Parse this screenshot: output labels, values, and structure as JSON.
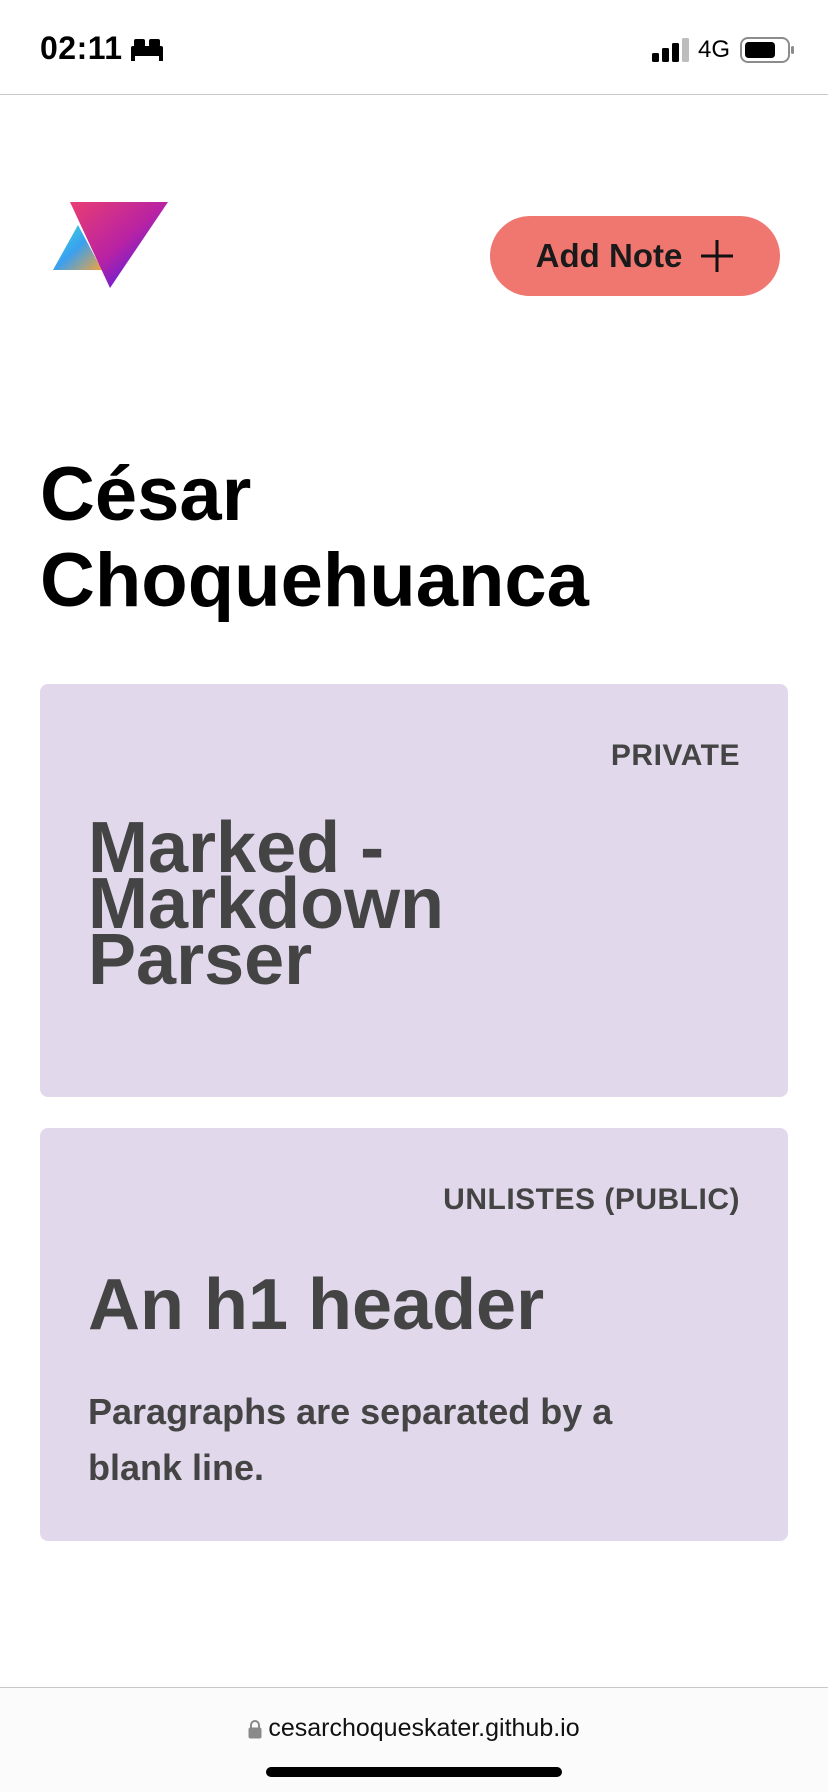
{
  "status_bar": {
    "time": "02:11",
    "network": "4G",
    "icons": [
      "sleep-icon",
      "signal-icon",
      "battery-icon"
    ]
  },
  "header": {
    "logo": "gradient-triangles-logo",
    "add_note_label": "Add Note",
    "add_note_icon": "plus-icon",
    "button_color": "#f07670"
  },
  "page": {
    "title": "César Choquehuanca"
  },
  "notes": [
    {
      "visibility": "PRIVATE",
      "heading": "Marked - Markdown Parser",
      "paragraph": ""
    },
    {
      "visibility": "UNLISTES (PUBLIC)",
      "heading": "An h1 header",
      "paragraph": "Paragraphs are separated by a blank line."
    }
  ],
  "colors": {
    "card_background": "#e1d9eb",
    "card_text": "#444444"
  },
  "url_bar": {
    "url": "cesarchoqueskater.github.io",
    "icon": "lock-icon"
  }
}
